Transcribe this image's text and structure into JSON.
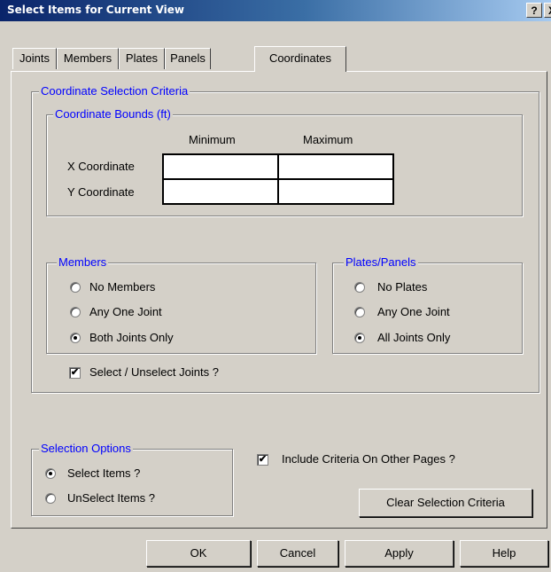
{
  "window": {
    "title": "Select Items for Current View",
    "help_glyph": "?",
    "close_glyph": "X"
  },
  "tabs": [
    {
      "label": "Joints"
    },
    {
      "label": "Members"
    },
    {
      "label": "Plates"
    },
    {
      "label": "Panels"
    },
    {
      "label": "Coordinates",
      "active": true
    }
  ],
  "coordinate_criteria": {
    "legend": "Coordinate Selection Criteria",
    "bounds": {
      "legend": "Coordinate Bounds  (ft)",
      "min_header": "Minimum",
      "max_header": "Maximum",
      "rows": [
        {
          "label": "X Coordinate",
          "min": "",
          "max": ""
        },
        {
          "label": "Y Coordinate",
          "min": "",
          "max": ""
        }
      ]
    },
    "members": {
      "legend": "Members",
      "options": [
        {
          "label": "No Members",
          "selected": false
        },
        {
          "label": "Any One Joint",
          "selected": false
        },
        {
          "label": "Both Joints Only",
          "selected": true
        }
      ]
    },
    "plates_panels": {
      "legend": "Plates/Panels",
      "options": [
        {
          "label": "No Plates",
          "selected": false
        },
        {
          "label": "Any One Joint",
          "selected": false
        },
        {
          "label": "All Joints Only",
          "selected": true
        }
      ]
    },
    "select_joints": {
      "label": "Select / Unselect Joints ?",
      "checked": true
    }
  },
  "selection_options": {
    "legend": "Selection Options",
    "options": [
      {
        "label": "Select Items ?",
        "selected": true
      },
      {
        "label": "UnSelect Items ?",
        "selected": false
      }
    ]
  },
  "include_other_pages": {
    "label": "Include Criteria On Other Pages ?",
    "checked": true
  },
  "clear_button": "Clear Selection Criteria",
  "buttons": {
    "ok": "OK",
    "cancel": "Cancel",
    "apply": "Apply",
    "help": "Help"
  },
  "check_glyph": "✔",
  "colors": {
    "legend": "#0000ff",
    "face": "#d4d0c8",
    "title_start": "#0a246a",
    "title_end": "#a6caf0"
  }
}
